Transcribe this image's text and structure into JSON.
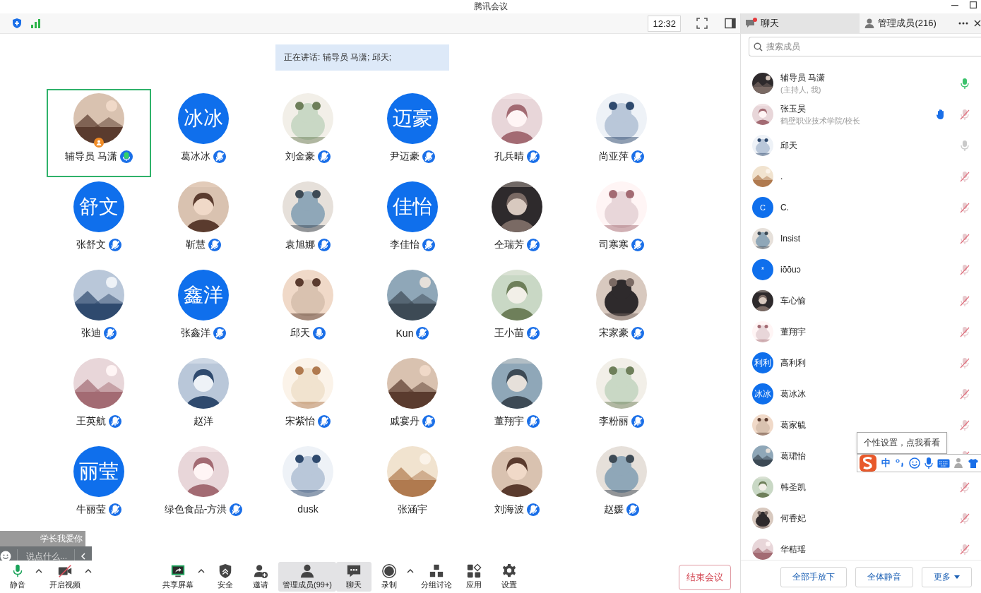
{
  "window": {
    "title": "腾讯会议"
  },
  "top_bar": {
    "time": "12:32"
  },
  "panel_tabs": [
    {
      "label": "聊天",
      "selected": true,
      "unread": true
    },
    {
      "label": "管理成员(216)",
      "selected": false
    }
  ],
  "speaking_banner": "正在讲话: 辅导员 马潇; 邱天;",
  "tiles": [
    {
      "name": "辅导员 马潇",
      "kind": "picture",
      "mic_shown": true,
      "speaking": true,
      "muted": false,
      "selected": true,
      "host": true
    },
    {
      "name": "葛冰冰",
      "kind": "letter",
      "initials": "冰冰",
      "mic_shown": true,
      "speaking": false,
      "muted": true,
      "selected": false,
      "host": false
    },
    {
      "name": "刘金豪",
      "kind": "picture",
      "mic_shown": true,
      "speaking": false,
      "muted": true,
      "selected": false,
      "host": false
    },
    {
      "name": "尹迈豪",
      "kind": "letter",
      "initials": "迈豪",
      "mic_shown": true,
      "speaking": false,
      "muted": true,
      "selected": false,
      "host": false
    },
    {
      "name": "孔兵晴",
      "kind": "picture",
      "mic_shown": true,
      "speaking": false,
      "muted": true,
      "selected": false,
      "host": false
    },
    {
      "name": "尚亚萍",
      "kind": "picture",
      "mic_shown": true,
      "speaking": false,
      "muted": true,
      "selected": false,
      "host": false
    },
    {
      "name": "张舒文",
      "kind": "letter",
      "initials": "舒文",
      "mic_shown": true,
      "speaking": false,
      "muted": true,
      "selected": false,
      "host": false
    },
    {
      "name": "靳慧",
      "kind": "picture",
      "mic_shown": true,
      "speaking": false,
      "muted": true,
      "selected": false,
      "host": false
    },
    {
      "name": "袁旭娜",
      "kind": "picture",
      "mic_shown": true,
      "speaking": false,
      "muted": true,
      "selected": false,
      "host": false
    },
    {
      "name": "李佳怡",
      "kind": "letter",
      "initials": "佳怡",
      "mic_shown": true,
      "speaking": false,
      "muted": true,
      "selected": false,
      "host": false
    },
    {
      "name": "仝瑞芳",
      "kind": "picture",
      "mic_shown": true,
      "speaking": false,
      "muted": true,
      "selected": false,
      "host": false
    },
    {
      "name": "司寒寒",
      "kind": "picture",
      "mic_shown": true,
      "speaking": false,
      "muted": true,
      "selected": false,
      "host": false
    },
    {
      "name": "张迪",
      "kind": "picture",
      "mic_shown": true,
      "speaking": false,
      "muted": true,
      "selected": false,
      "host": false
    },
    {
      "name": "张鑫洋",
      "kind": "letter",
      "initials": "鑫洋",
      "mic_shown": true,
      "speaking": false,
      "muted": true,
      "selected": false,
      "host": false
    },
    {
      "name": "邱天",
      "kind": "picture",
      "mic_shown": true,
      "speaking": false,
      "muted": false,
      "selected": false,
      "host": false
    },
    {
      "name": "Kun",
      "kind": "picture",
      "mic_shown": true,
      "speaking": false,
      "muted": true,
      "selected": false,
      "host": false
    },
    {
      "name": "王小苗",
      "kind": "picture",
      "mic_shown": true,
      "speaking": false,
      "muted": true,
      "selected": false,
      "host": false
    },
    {
      "name": "宋家豪",
      "kind": "picture",
      "mic_shown": true,
      "speaking": false,
      "muted": true,
      "selected": false,
      "host": false
    },
    {
      "name": "王英航",
      "kind": "picture",
      "mic_shown": true,
      "speaking": false,
      "muted": true,
      "selected": false,
      "host": false
    },
    {
      "name": "赵洋",
      "kind": "picture",
      "mic_shown": false,
      "selected": false,
      "host": false
    },
    {
      "name": "宋紫怡",
      "kind": "picture",
      "mic_shown": true,
      "speaking": false,
      "muted": true,
      "selected": false,
      "host": false
    },
    {
      "name": "戚宴丹",
      "kind": "picture",
      "mic_shown": true,
      "speaking": false,
      "muted": true,
      "selected": false,
      "host": false
    },
    {
      "name": "董翔宇",
      "kind": "picture",
      "mic_shown": true,
      "speaking": false,
      "muted": true,
      "selected": false,
      "host": false
    },
    {
      "name": "李粉丽",
      "kind": "picture",
      "mic_shown": true,
      "speaking": false,
      "muted": true,
      "selected": false,
      "host": false
    },
    {
      "name": "牛丽莹",
      "kind": "letter",
      "initials": "丽莹",
      "mic_shown": true,
      "speaking": false,
      "muted": true,
      "selected": false,
      "host": false
    },
    {
      "name": "绿色食品-方洪",
      "kind": "picture",
      "mic_shown": true,
      "speaking": false,
      "muted": true,
      "selected": false,
      "host": false
    },
    {
      "name": "dusk",
      "kind": "picture",
      "mic_shown": false,
      "selected": false,
      "host": false
    },
    {
      "name": "张涵宇",
      "kind": "picture",
      "mic_shown": false,
      "selected": false,
      "host": false
    },
    {
      "name": "刘海波",
      "kind": "picture",
      "mic_shown": true,
      "speaking": false,
      "muted": true,
      "selected": false,
      "host": false
    },
    {
      "name": "赵媛",
      "kind": "picture",
      "mic_shown": true,
      "speaking": false,
      "muted": true,
      "selected": false,
      "host": false
    }
  ],
  "chat_overlay": {
    "message": "学长我爱你",
    "placeholder": "说点什么..."
  },
  "toolbar": [
    {
      "label": "静音",
      "kind": "mic",
      "caret": true,
      "active": false
    },
    {
      "label": "开启视频",
      "kind": "video_off",
      "caret": true,
      "active": false
    },
    {
      "label": "共享屏幕",
      "kind": "share",
      "caret": true,
      "active": false
    },
    {
      "label": "安全",
      "kind": "shield",
      "caret": false,
      "active": false
    },
    {
      "label": "邀请",
      "kind": "invite",
      "caret": false,
      "active": false
    },
    {
      "label": "管理成员(99+)",
      "kind": "members",
      "caret": false,
      "active": true
    },
    {
      "label": "聊天",
      "kind": "chat",
      "caret": false,
      "active": true
    },
    {
      "label": "录制",
      "kind": "record",
      "caret": true,
      "active": false
    },
    {
      "label": "分组讨论",
      "kind": "breakout",
      "caret": false,
      "active": false
    },
    {
      "label": "应用",
      "kind": "apps",
      "caret": false,
      "active": false
    },
    {
      "label": "设置",
      "kind": "settings",
      "caret": false,
      "active": false
    }
  ],
  "end_button": "结束会议",
  "members": {
    "search_placeholder": "搜索成员",
    "list": [
      {
        "name": "辅导员 马潇",
        "subtitle": "(主持人, 我)",
        "kind": "picture",
        "speaking": true,
        "muted": false,
        "hand_raised": false
      },
      {
        "name": "张玉昊",
        "subtitle": "鹤壁职业技术学院/校长",
        "kind": "picture",
        "speaking": false,
        "muted": true,
        "hand_raised": true
      },
      {
        "name": "邱天",
        "kind": "picture",
        "speaking": false,
        "muted": false,
        "hand_raised": false
      },
      {
        "name": ".",
        "kind": "picture",
        "speaking": false,
        "muted": true,
        "hand_raised": false
      },
      {
        "name": "C.",
        "kind": "letter",
        "initials": "C",
        "speaking": false,
        "muted": true,
        "hand_raised": false
      },
      {
        "name": "Insist",
        "kind": "picture",
        "speaking": false,
        "muted": true,
        "hand_raised": false
      },
      {
        "name": "iŏŏuↄ",
        "kind": "letter",
        "initials": "*",
        "speaking": false,
        "muted": true,
        "hand_raised": false
      },
      {
        "name": "车心愉",
        "kind": "picture",
        "speaking": false,
        "muted": true,
        "hand_raised": false
      },
      {
        "name": "董翔宇",
        "kind": "picture",
        "speaking": false,
        "muted": true,
        "hand_raised": false
      },
      {
        "name": "高利利",
        "kind": "letter",
        "initials": "利利",
        "speaking": false,
        "muted": true,
        "hand_raised": false
      },
      {
        "name": "葛冰冰",
        "kind": "letter",
        "initials": "冰冰",
        "speaking": false,
        "muted": true,
        "hand_raised": false
      },
      {
        "name": "葛家毓",
        "kind": "picture",
        "speaking": false,
        "muted": true,
        "hand_raised": false
      },
      {
        "name": "葛珺怡",
        "kind": "picture",
        "speaking": false,
        "muted": true,
        "hand_raised": false
      },
      {
        "name": "韩圣凯",
        "kind": "picture",
        "speaking": false,
        "muted": true,
        "hand_raised": false
      },
      {
        "name": "何香妃",
        "kind": "picture",
        "speaking": false,
        "muted": true,
        "hand_raised": false
      },
      {
        "name": "华秸瑶",
        "kind": "picture",
        "speaking": false,
        "muted": true,
        "hand_raised": false
      }
    ],
    "buttons": [
      "全部手放下",
      "全体静音",
      "更多"
    ]
  },
  "ime_bar": {
    "tooltip": "个性设置，点我看看",
    "mode": "中"
  }
}
